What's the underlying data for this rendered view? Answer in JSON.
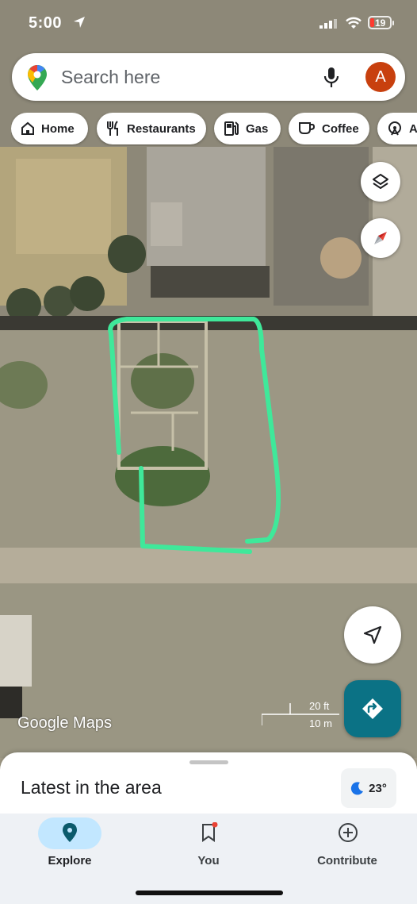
{
  "status_bar": {
    "time": "5:00",
    "battery": "19"
  },
  "search": {
    "placeholder": "Search here",
    "avatar_letter": "A"
  },
  "chips": [
    {
      "label": "Home",
      "icon": "home-icon"
    },
    {
      "label": "Restaurants",
      "icon": "fork-knife-icon"
    },
    {
      "label": "Gas",
      "icon": "gas-pump-icon"
    },
    {
      "label": "Coffee",
      "icon": "coffee-cup-icon"
    },
    {
      "label": "A",
      "icon": "attractions-icon"
    }
  ],
  "map": {
    "watermark": "Google Maps",
    "scale_ft": "20 ft",
    "scale_m": "10 m",
    "highlight_color": "#3fe89a"
  },
  "sheet": {
    "title": "Latest in the area",
    "weather": "23°"
  },
  "bottom_nav": [
    {
      "label": "Explore",
      "icon": "explore-pin-icon",
      "active": true
    },
    {
      "label": "You",
      "icon": "bookmark-icon",
      "active": false
    },
    {
      "label": "Contribute",
      "icon": "add-circle-icon",
      "active": false
    }
  ],
  "colors": {
    "accent": "#0b7285",
    "avatar": "#c8400e",
    "active_pill": "#c2e7ff"
  }
}
